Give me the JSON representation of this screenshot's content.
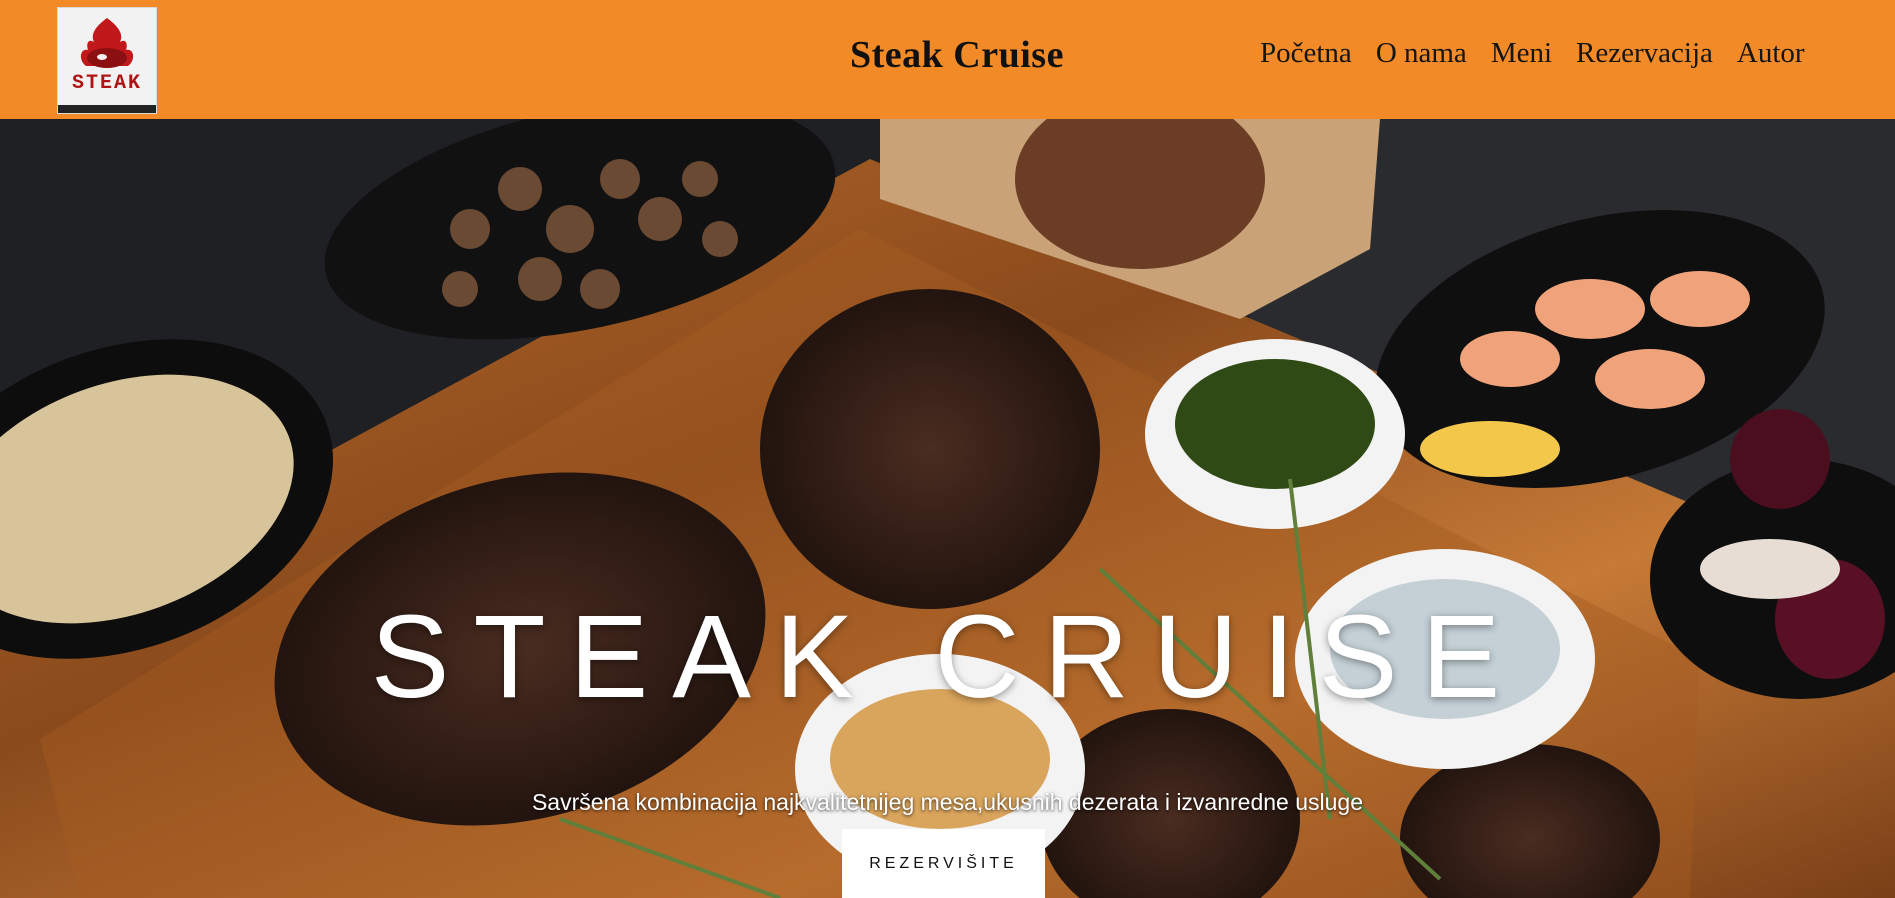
{
  "header": {
    "logo_text": "STEAK",
    "brand": "Steak Cruise",
    "nav": [
      "Početna",
      "O nama",
      "Meni",
      "Rezervacija",
      "Autor"
    ]
  },
  "hero": {
    "title": "STEAK CRUISE",
    "subtitle": "Savršena kombinacija najkvalitetnijeg mesa,ukusnih dezerata i izvanredne usluge",
    "cta_label": "REZERVIŠITE"
  },
  "colors": {
    "header_bg": "#f28a28",
    "cta_bg": "#ffffff"
  },
  "icons": {
    "logo": "steak-logo-icon"
  }
}
